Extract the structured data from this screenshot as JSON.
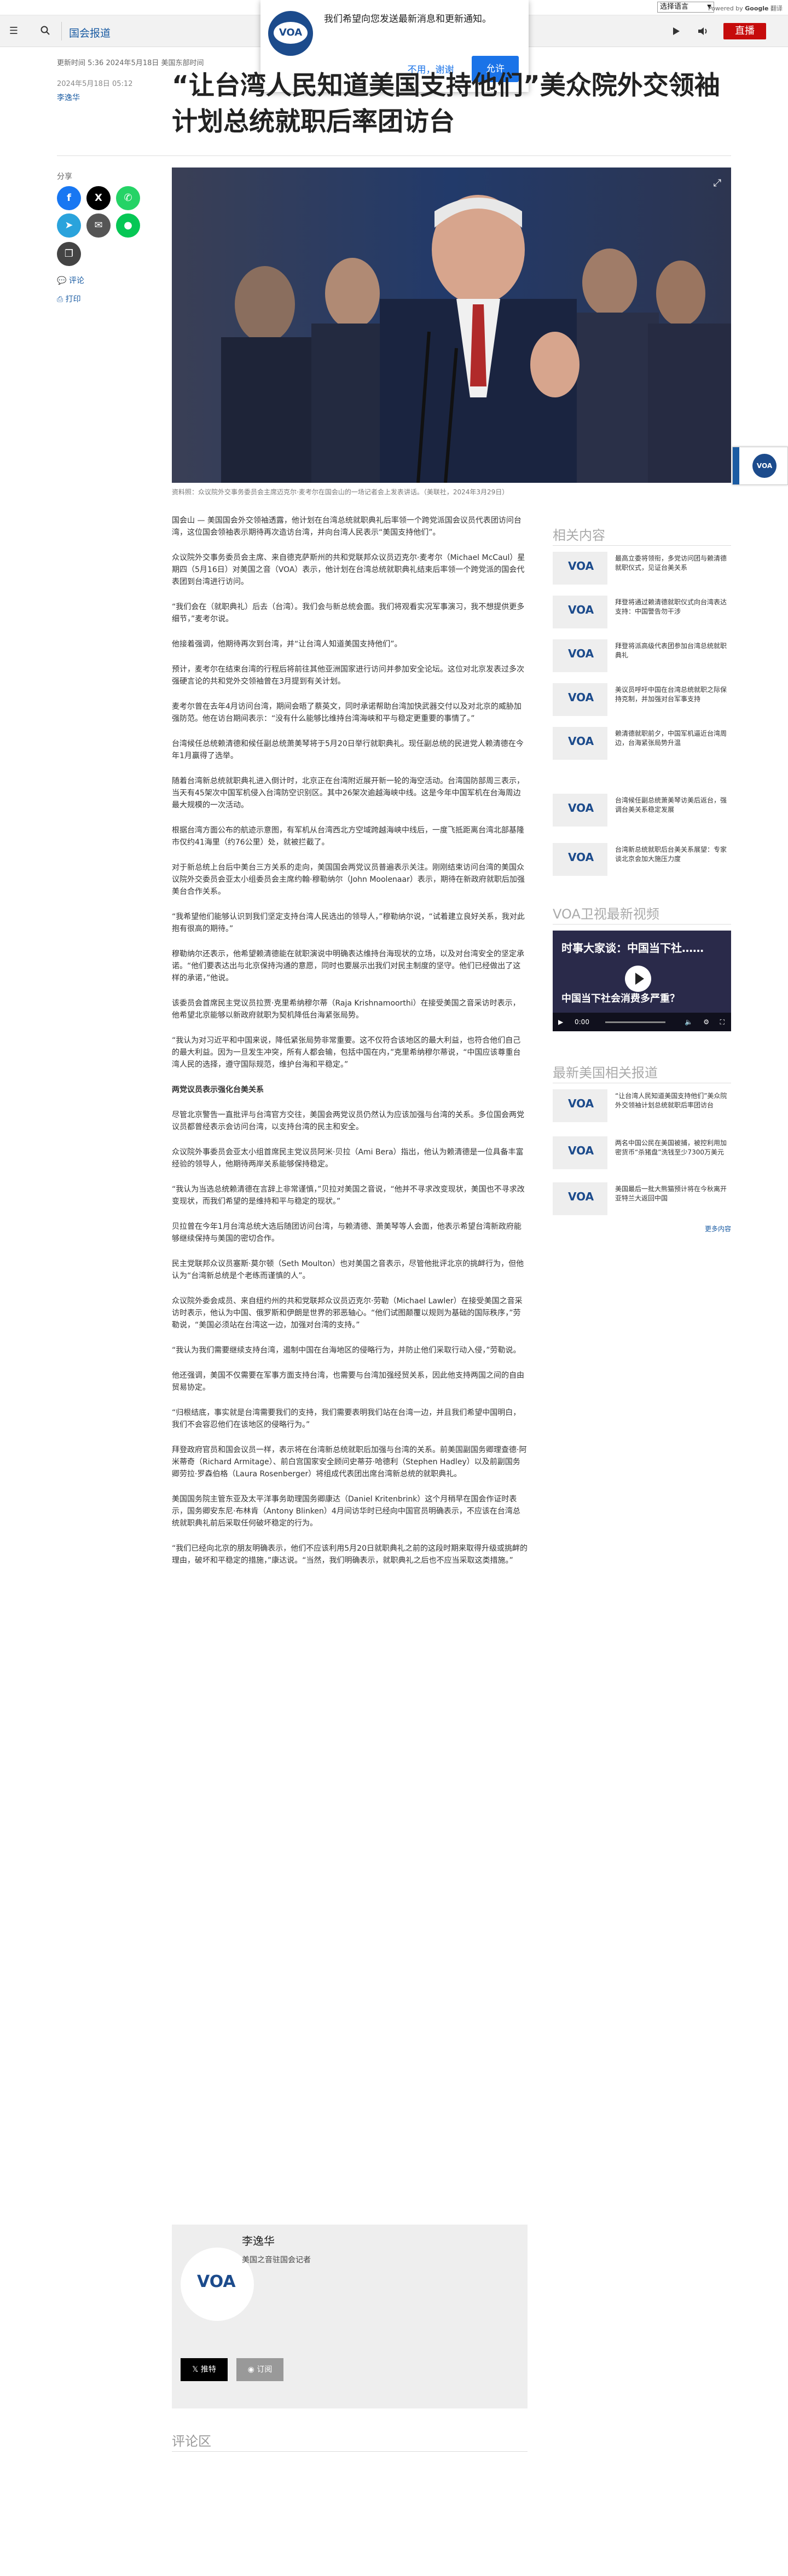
{
  "translate": {
    "language_select": "选择语言",
    "powered_by": "Powered by",
    "google": "Google",
    "translate_word": "翻译"
  },
  "header": {
    "section": "国会报道",
    "live_label": "直播",
    "icons": [
      "menu-icon",
      "search-icon",
      "play-icon",
      "audio-icon"
    ]
  },
  "notification": {
    "text": "我们希望向您发送最新消息和更新通知。",
    "decline": "不用，谢谢",
    "accept": "允许"
  },
  "meta": {
    "updated": "更新时间 5:36 2024年5月18日 美国东部时间",
    "published": "2024年5月18日 05:12",
    "author": "李逸华"
  },
  "article": {
    "headline": "“让台湾人民知道美国支持他们”美众院外交领袖计划总统就职后率团访台",
    "share_label": "分享",
    "comments_link": "评论",
    "print_link": "打印",
    "image_caption": "资料照：众议院外交事务委员会主席迈克尔·麦考尔在国会山的一场记者会上发表讲话。（美联社，2024年3月29日）",
    "paragraphs": [
      "国会山 — 美国国会外交领袖透露，他计划在台湾总统就职典礼后率领一个跨党派国会议员代表团访问台湾，这位国会领袖表示期待再次造访台湾，并向台湾人民表示“美国支持他们”。",
      "众议院外交事务委员会主席、来自德克萨斯州的共和党联邦众议员迈克尔·麦考尔（Michael McCaul）星期四（5月16日）对美国之音（VOA）表示，他计划在台湾总统就职典礼结束后率领一个跨党派的国会代表团到台湾进行访问。",
      "“我们会在（就职典礼）后去（台湾）。我们会与新总统会面。我们将观看实况军事演习，我不想提供更多细节，”麦考尔说。",
      "他接着强调，他期待再次到台湾，并“让台湾人知道美国支持他们”。",
      "预计，麦考尔在结束台湾的行程后将前往其他亚洲国家进行访问并参加安全论坛。这位对北京发表过多次强硬言论的共和党外交领袖曾在3月提到有关计划。",
      "麦考尔曾在去年4月访问台湾，期间会晤了蔡英文，同时承诺帮助台湾加快武器交付以及对北京的威胁加强防范。他在访台期间表示：“没有什么能够比维持台湾海峡和平与稳定更重要的事情了。”",
      "台湾候任总统赖清德和候任副总统萧美琴将于5月20日举行就职典礼。现任副总统的民进党人赖清德在今年1月赢得了选举。",
      "随着台湾新总统就职典礼进入倒计时，北京正在台湾附近展开新一轮的海空活动。台湾国防部周三表示，当天有45架次中国军机侵入台湾防空识别区。其中26架次逾越海峡中线。这是今年中国军机在台海周边最大规模的一次活动。",
      "根据台湾方面公布的航迹示意图，有军机从台湾西北方空域跨越海峡中线后，一度飞抵距离台湾北部基隆市仅约41海里（约76公里）处，就被拦截了。",
      "对于新总统上台后中美台三方关系的走向，美国国会两党议员普遍表示关注。刚刚结束访问台湾的美国众议院外交委员会亚太小组委员会主席约翰·穆勒纳尔（John Moolenaar）表示，期待在新政府就职后加强美台合作关系。",
      "“我希望他们能够认识到我们坚定支持台湾人民选出的领导人，”穆勒纳尔说，“试着建立良好关系，我对此抱有很高的期待。”",
      "穆勒纳尔还表示，他希望赖清德能在就职演说中明确表达维持台海现状的立场，以及对台湾安全的坚定承诺。“他们要表达出与北京保持沟通的意愿，同时也要展示出我们对民主制度的坚守。他们已经做出了这样的承诺，”他说。",
      "该委员会首席民主党议员拉贾·克里希纳穆尔蒂（Raja Krishnamoorthi）在接受美国之音采访时表示，他希望北京能够以新政府就职为契机降低台海紧张局势。",
      "“我认为对习近平和中国来说，降低紧张局势非常重要。这不仅符合该地区的最大利益，也符合他们自己的最大利益。因为一旦发生冲突，所有人都会输，包括中国在内，”克里希纳穆尔蒂说，“中国应该尊重台湾人民的选择，遵守国际规范，维护台海和平稳定。”",
      "两党议员表示强化台美关系",
      "尽管北京警告一直批评与台湾官方交往，美国会两党议员仍然认为应该加强与台湾的关系。多位国会两党议员都曾经表示会访问台湾，以支持台湾的民主和安全。",
      "众议院外事委员会亚太小组首席民主党议员阿米·贝拉（Ami Bera）指出，他认为赖清德是一位具备丰富经验的领导人，他期待两岸关系能够保持稳定。",
      "“我认为当选总统赖清德在言辞上非常谨慎，”贝拉对美国之音说，“他并不寻求改变现状，美国也不寻求改变现状，而我们希望的是维持和平与稳定的现状。”",
      "贝拉曾在今年1月台湾总统大选后随团访问台湾，与赖清德、萧美琴等人会面，他表示希望台湾新政府能够继续保持与美国的密切合作。",
      "民主党联邦众议员塞斯·莫尔顿（Seth Moulton）也对美国之音表示，尽管他批评北京的挑衅行为，但他认为“台湾新总统是个老练而谨慎的人”。",
      "众议院外委会成员、来自纽约州的共和党联邦众议员迈克尔·劳勒（Michael Lawler）在接受美国之音采访时表示，他认为中国、俄罗斯和伊朗是世界的邪恶轴心。“他们试图颠覆以规则为基础的国际秩序，”劳勒说，“美国必须站在台湾这一边，加强对台湾的支持。”",
      "“我认为我们需要继续支持台湾，遏制中国在台海地区的侵略行为，并防止他们采取行动入侵，”劳勒说。",
      "他还强调，美国不仅需要在军事方面支持台湾，也需要与台湾加强经贸关系，因此他支持两国之间的自由贸易协定。",
      "“归根结底，事实就是台湾需要我们的支持，我们需要表明我们站在台湾一边，并且我们希望中国明白，我们不会容忍他们在该地区的侵略行为。”",
      "拜登政府官员和国会议员一样，表示将在台湾新总统就职后加强与台湾的关系。前美国副国务卿理查德·阿米蒂奇（Richard Armitage）、前白宫国家安全顾问史蒂芬·哈德利（Stephen Hadley）以及前副国务卿劳拉·罗森伯格（Laura Rosenberger）将组成代表团出席台湾新总统的就职典礼。",
      "美国国务院主管东亚及太平洋事务助理国务卿康达（Daniel Kritenbrink）这个月稍早在国会作证时表示，国务卿安东尼·布林肯（Antony Blinken）4月间访华时已经向中国官员明确表示，不应该在台湾总统就职典礼前后采取任何破坏稳定的行为。",
      "“我们已经向北京的朋友明确表示，他们不应该利用5月20日就职典礼之前的这段时期来取得升级或挑衅的理由，破坏和平稳定的措施，”康达说。“当然，我们明确表示，就职典礼之后也不应当采取这类措施。”"
    ]
  },
  "author_box": {
    "name": "李逸华",
    "title": "美国之音驻国会记者",
    "tweet": "推特",
    "subscribe": "订阅"
  },
  "comments": {
    "heading": "评论区"
  },
  "sidebar": {
    "related_heading": "相关内容",
    "related": [
      "最高立委将领衔，多党访问团与赖清德就职仪式，见证台美关系",
      "拜登将通过赖清德就职仪式向台湾表达支持：中国警告勿干涉",
      "拜登将派高级代表团参加台湾总统就职典礼",
      "美议员呼吁中国在台湾总统就职之际保持克制，并加强对台军事支持",
      "赖清德就职前夕，中国军机逼近台湾周边，台海紧张局势升温",
      "台湾候任副总统萧美琴访美后返台，强调台美关系稳定发展",
      "台湾新总统就职后台美关系展望：专家谈北京会加大施压力度"
    ],
    "video_heading": "VOA卫视最新视频",
    "video": {
      "title": "时事大家谈：中国当下社……",
      "subtitle": "中国当下社会消费多严重？",
      "time": "0:00"
    },
    "us_heading": "最新美国相关报道",
    "us_related": [
      "“让台湾人民知道美国支持他们”美众院外交领袖计划总统就职后率团访台",
      "两名中国公民在美国被捕，被控利用加密货币“杀猪盘”洗钱至少7300万美元",
      "美国最后一批大熊猫预计将在今秋离开亚特兰大返回中国"
    ],
    "more_label": "更多内容"
  },
  "widget": {
    "label": "VOA"
  }
}
